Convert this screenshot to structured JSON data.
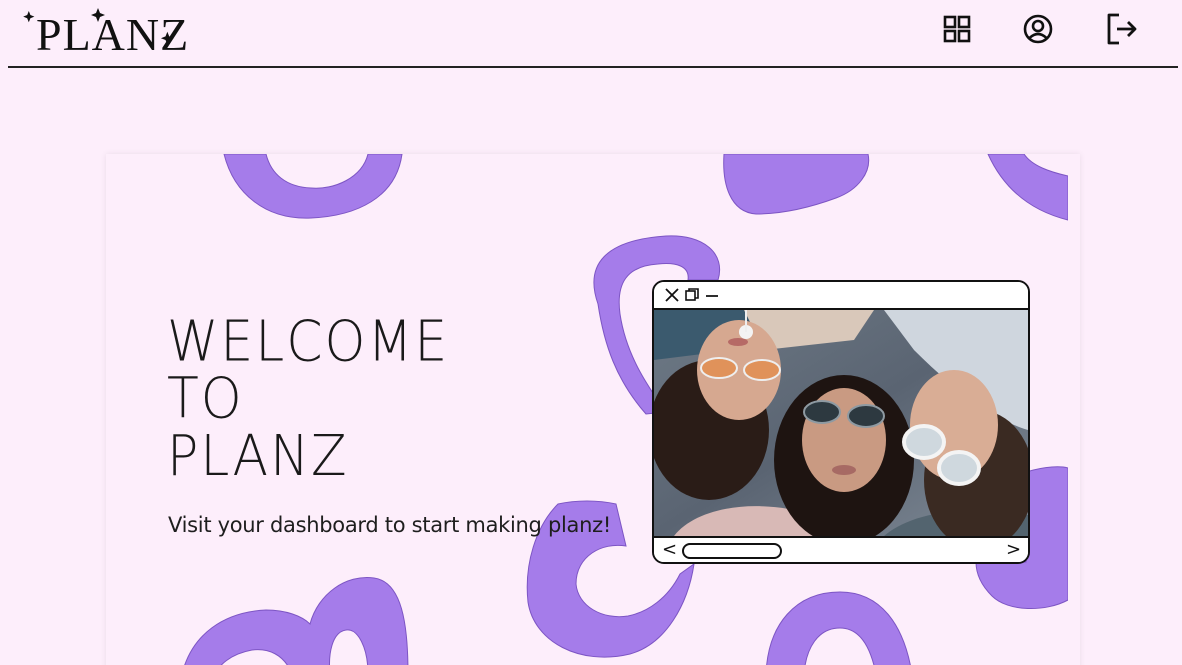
{
  "app": {
    "logo_text": "PLANZ"
  },
  "header": {
    "icons": [
      {
        "name": "dashboard-grid-icon"
      },
      {
        "name": "user-account-icon"
      },
      {
        "name": "logout-icon"
      }
    ]
  },
  "hero": {
    "welcome_lines": [
      "WELCOME",
      "TO",
      "PLANZ"
    ],
    "subtitle": "Visit your dashboard to start making planz!"
  },
  "window_mock": {
    "prev_label": "<",
    "next_label": ">",
    "photo": "three friends lying down wearing sunglasses"
  },
  "colors": {
    "background": "#fdeefb",
    "accent_blob": "#a57cea",
    "ink": "#111111"
  }
}
